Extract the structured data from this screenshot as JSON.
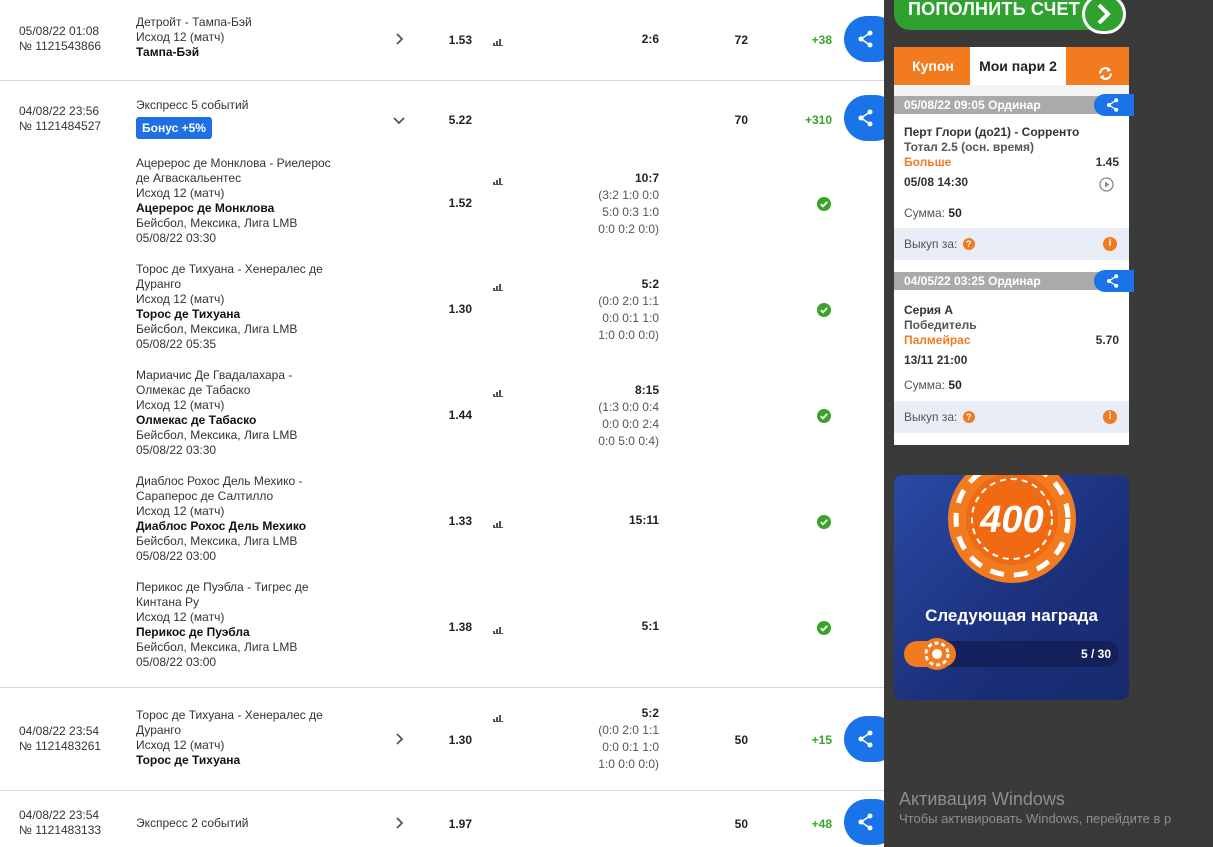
{
  "bets": [
    {
      "datetime": "05/08/22 01:08",
      "number": "№ 1121543866",
      "title": "Детройт - Тампа-Бэй",
      "market": "Исход 12 (матч)",
      "selection": "Тампа-Бэй",
      "coef": "1.53",
      "score": "2:6",
      "stake": "72",
      "win": "+38"
    },
    {
      "datetime": "04/08/22 23:56",
      "number": "№ 1121484527",
      "title": "Экспресс 5 событий",
      "bonus": "Бонус +5%",
      "coef": "5.22",
      "stake": "70",
      "win": "+310",
      "events": [
        {
          "title1": "Ацерерос де Монклова - Риелерос",
          "title2": "де Агваскальентес",
          "market": "Исход 12 (матч)",
          "selection": "Ацерерос де Монклова",
          "league": "Бейсбол, Мексика, Лига LMB",
          "date": "05/08/22 03:30",
          "coef": "1.52",
          "score": "10:7",
          "sub1": "(3:2 1:0 0:0",
          "sub2": "5:0 0:3 1:0",
          "sub3": "0:0 0:2 0:0)"
        },
        {
          "title1": "Торос де Тихуана - Хенералес де",
          "title2": "Дуранго",
          "market": "Исход 12 (матч)",
          "selection": "Торос де Тихуана",
          "league": "Бейсбол, Мексика, Лига LMB",
          "date": "05/08/22 05:35",
          "coef": "1.30",
          "score": "5:2",
          "sub1": "(0:0 2:0 1:1",
          "sub2": "0:0 0:1 1:0",
          "sub3": "1:0 0:0 0:0)"
        },
        {
          "title1": "Мариачис Де Гвадалахара -",
          "title2": "Олмекас де Табаско",
          "market": "Исход 12 (матч)",
          "selection": "Олмекас де Табаско",
          "league": "Бейсбол, Мексика, Лига LMB",
          "date": "05/08/22 03:30",
          "coef": "1.44",
          "score": "8:15",
          "sub1": "(1:3 0:0 0:4",
          "sub2": "0:0 0:0 2:4",
          "sub3": "0:0 5:0 0:4)"
        },
        {
          "title1": "Диаблос Рохос Дель Мехико -",
          "title2": "Сараперос де Салтилло",
          "market": "Исход 12 (матч)",
          "selection": "Диаблос Рохос Дель Мехико",
          "league": "Бейсбол, Мексика, Лига LMB",
          "date": "05/08/22 03:00",
          "coef": "1.33",
          "score": "15:11"
        },
        {
          "title1": "Перикос де Пуэбла - Тигрес де",
          "title2": "Кинтана Ру",
          "market": "Исход 12 (матч)",
          "selection": "Перикос де Пуэбла",
          "league": "Бейсбол, Мексика, Лига LMB",
          "date": "05/08/22 03:00",
          "coef": "1.38",
          "score": "5:1"
        }
      ]
    },
    {
      "datetime": "04/08/22 23:54",
      "number": "№ 1121483261",
      "title1": "Торос де Тихуана - Хенералес де",
      "title2": "Дуранго",
      "market": "Исход 12 (матч)",
      "selection": "Торос де Тихуана",
      "coef": "1.30",
      "score": "5:2",
      "sub1": "(0:0 2:0 1:1",
      "sub2": "0:0 0:1 1:0",
      "sub3": "1:0 0:0 0:0)",
      "stake": "50",
      "win": "+15"
    },
    {
      "datetime": "04/08/22 23:54",
      "number": "№ 1121483133",
      "title": "Экспресс 2 событий",
      "coef": "1.97",
      "stake": "50",
      "win": "+48"
    }
  ],
  "right": {
    "topup_label": "ПОПОЛНИТЬ СЧЕТ",
    "tab_coupon": "Купон",
    "tab_mybets": "Мои пари 2",
    "slips": [
      {
        "header": "05/08/22 09:05   Ординар",
        "event": "Перт Глори (до21) - Сорренто",
        "market": "Тотал 2.5 (осн. время)",
        "selection": "Больше",
        "odds": "1.45",
        "date": "05/08 14:30",
        "sum_label": "Сумма:",
        "sum_value": "50",
        "buyout_label": "Выкуп за:"
      },
      {
        "header": "04/05/22 03:25   Ординар",
        "event": "Серия А",
        "market": "Победитель",
        "selection": "Палмейрас",
        "odds": "5.70",
        "date": "13/11 21:00",
        "sum_label": "Сумма:",
        "sum_value": "50",
        "buyout_label": "Выкуп за:"
      }
    ],
    "reward": {
      "chip_value": "400",
      "title": "Следующая награда",
      "progress_text": "5 / 30",
      "progress_fraction": 0.1667
    },
    "windows": {
      "title": "Активация Windows",
      "subtitle": "Чтобы активировать Windows, перейдите в р"
    }
  },
  "colors": {
    "accent_orange": "#f27b20",
    "share_blue": "#1a73e8",
    "win_green": "#3aa329",
    "bonus_blue": "#1f6fe5"
  },
  "icons": [
    "chevron-right-icon",
    "chevron-down-icon",
    "stats-bars-icon",
    "share-icon",
    "check-circle-icon",
    "refresh-icon",
    "play-circle-icon",
    "question-icon",
    "info-icon",
    "chip-icon",
    "arrow-right-icon"
  ]
}
